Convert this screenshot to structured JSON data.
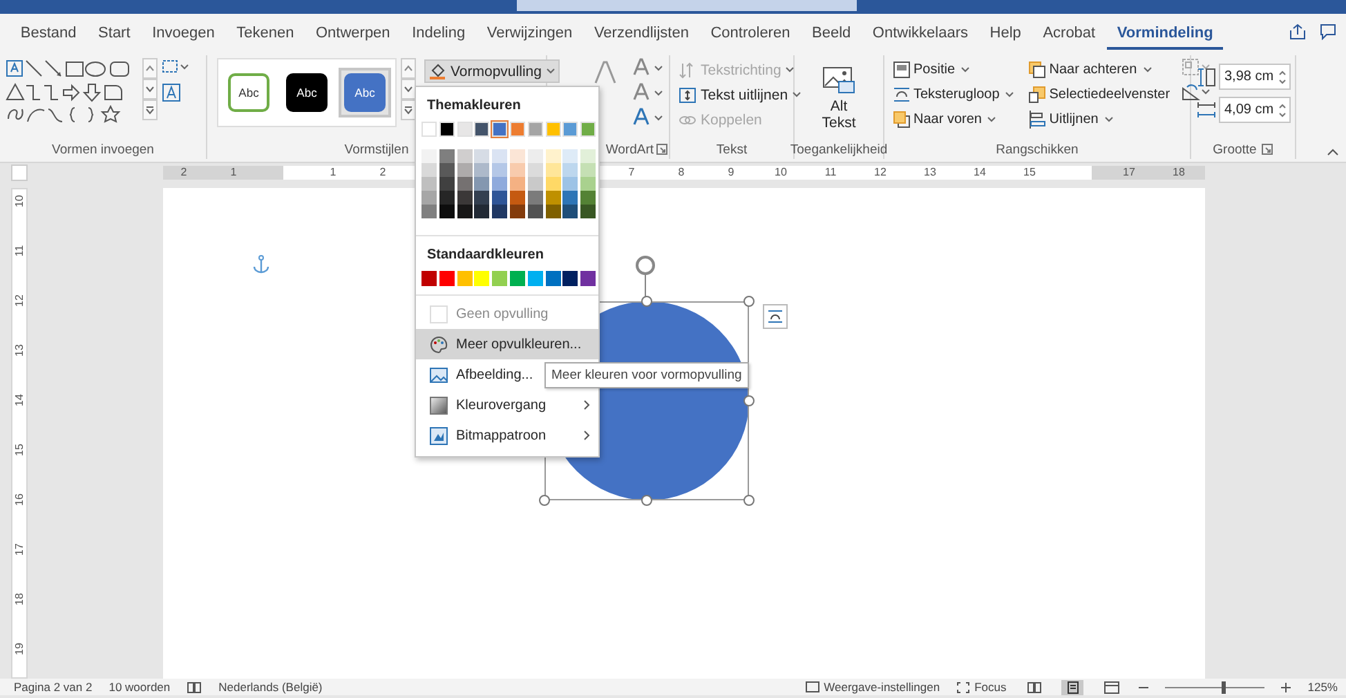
{
  "tabs": [
    {
      "label": "Bestand",
      "selected": false
    },
    {
      "label": "Start",
      "selected": false
    },
    {
      "label": "Invoegen",
      "selected": false
    },
    {
      "label": "Tekenen",
      "selected": false
    },
    {
      "label": "Ontwerpen",
      "selected": false
    },
    {
      "label": "Indeling",
      "selected": false
    },
    {
      "label": "Verwijzingen",
      "selected": false
    },
    {
      "label": "Verzendlijsten",
      "selected": false
    },
    {
      "label": "Controleren",
      "selected": false
    },
    {
      "label": "Beeld",
      "selected": false
    },
    {
      "label": "Ontwikkelaars",
      "selected": false
    },
    {
      "label": "Help",
      "selected": false
    },
    {
      "label": "Acrobat",
      "selected": false
    },
    {
      "label": "Vormindeling",
      "selected": true
    }
  ],
  "ribbon": {
    "insert_shapes": {
      "label": "Vormen invoegen"
    },
    "shape_styles": {
      "label": "Vormstijlen",
      "fill_button": "Vormopvulling",
      "presets": [
        {
          "label": "Abc",
          "kind": "outline",
          "color": "#70ad47",
          "selected": false
        },
        {
          "label": "Abc",
          "kind": "filled",
          "color": "#000000",
          "selected": false
        },
        {
          "label": "Abc",
          "kind": "filled",
          "color": "#4472c4",
          "selected": true
        }
      ]
    },
    "wordart": {
      "label": "WordArt"
    },
    "text": {
      "label": "Tekst",
      "buttons": [
        {
          "label": "Tekstrichting",
          "kind": "direction",
          "disabled": true
        },
        {
          "label": "Tekst uitlijnen",
          "kind": "align",
          "disabled": false
        },
        {
          "label": "Koppelen",
          "kind": "link",
          "disabled": true
        }
      ]
    },
    "accessibility": {
      "label": "Toegankelijkheid",
      "button": "Alt Tekst"
    },
    "arrange": {
      "label": "Rangschikken",
      "buttons": [
        {
          "label": "Positie",
          "kind": "position",
          "dropdown": true
        },
        {
          "label": "Teksterugloop",
          "kind": "wrap",
          "dropdown": true
        },
        {
          "label": "Naar voren",
          "kind": "forward",
          "dropdown": true
        },
        {
          "label": "Naar achteren",
          "kind": "backward",
          "dropdown": true
        },
        {
          "label": "Selectiedeelvenster",
          "kind": "pane",
          "dropdown": false
        },
        {
          "label": "Uitlijnen",
          "kind": "align",
          "dropdown": true
        }
      ]
    },
    "size": {
      "label": "Grootte",
      "height": "3,98 cm",
      "width": "4,09 cm"
    }
  },
  "rulers": {
    "horizontal": [
      "2",
      "1",
      "1",
      "2",
      "7",
      "8",
      "9",
      "10",
      "11",
      "12",
      "13",
      "14",
      "15",
      "17",
      "18"
    ],
    "vertical": [
      "10",
      "11",
      "12",
      "13",
      "14",
      "15",
      "16",
      "17",
      "18",
      "19"
    ]
  },
  "shape": {
    "selected": true
  },
  "fill_menu": {
    "theme_title": "Themakleuren",
    "theme_colors": [
      {
        "color": "#ffffff",
        "shades": [
          {
            "color": "#f2f2f2"
          },
          {
            "color": "#d9d9d9"
          },
          {
            "color": "#bfbfbf"
          },
          {
            "color": "#a6a6a6"
          },
          {
            "color": "#808080"
          }
        ],
        "selected": false
      },
      {
        "color": "#000000",
        "shades": [
          {
            "color": "#7f7f7f"
          },
          {
            "color": "#595959"
          },
          {
            "color": "#404040"
          },
          {
            "color": "#262626"
          },
          {
            "color": "#0d0d0d"
          }
        ],
        "selected": false
      },
      {
        "color": "#e7e6e6",
        "shades": [
          {
            "color": "#d0cece"
          },
          {
            "color": "#aeabab"
          },
          {
            "color": "#757171"
          },
          {
            "color": "#3b3838"
          },
          {
            "color": "#181717"
          }
        ],
        "selected": false
      },
      {
        "color": "#44546a",
        "shades": [
          {
            "color": "#d6dce5"
          },
          {
            "color": "#adb9ca"
          },
          {
            "color": "#8497b0"
          },
          {
            "color": "#333f50"
          },
          {
            "color": "#222a35"
          }
        ],
        "selected": false
      },
      {
        "color": "#4472c4",
        "shades": [
          {
            "color": "#dae3f3"
          },
          {
            "color": "#b4c7e7"
          },
          {
            "color": "#8faadc"
          },
          {
            "color": "#2f5597"
          },
          {
            "color": "#203864"
          }
        ],
        "selected": true
      },
      {
        "color": "#ed7d31",
        "shades": [
          {
            "color": "#fbe5d6"
          },
          {
            "color": "#f8cbad"
          },
          {
            "color": "#f4b183"
          },
          {
            "color": "#c55a11"
          },
          {
            "color": "#843c0c"
          }
        ],
        "selected": false
      },
      {
        "color": "#a5a5a5",
        "shades": [
          {
            "color": "#ededed"
          },
          {
            "color": "#dbdbdb"
          },
          {
            "color": "#c9c9c9"
          },
          {
            "color": "#7b7b7b"
          },
          {
            "color": "#525252"
          }
        ],
        "selected": false
      },
      {
        "color": "#ffc000",
        "shades": [
          {
            "color": "#fff2cc"
          },
          {
            "color": "#ffe699"
          },
          {
            "color": "#ffd966"
          },
          {
            "color": "#bf9000"
          },
          {
            "color": "#7f6000"
          }
        ],
        "selected": false
      },
      {
        "color": "#5b9bd5",
        "shades": [
          {
            "color": "#deebf7"
          },
          {
            "color": "#bdd7ee"
          },
          {
            "color": "#9dc3e6"
          },
          {
            "color": "#2e75b6"
          },
          {
            "color": "#1f4e79"
          }
        ],
        "selected": false
      },
      {
        "color": "#70ad47",
        "shades": [
          {
            "color": "#e2f0d9"
          },
          {
            "color": "#c5e0b4"
          },
          {
            "color": "#a9d18e"
          },
          {
            "color": "#548235"
          },
          {
            "color": "#385723"
          }
        ],
        "selected": false
      }
    ],
    "standard_title": "Standaardkleuren",
    "standard_colors": [
      {
        "color": "#c00000"
      },
      {
        "color": "#ff0000"
      },
      {
        "color": "#ffc000"
      },
      {
        "color": "#ffff00"
      },
      {
        "color": "#92d050"
      },
      {
        "color": "#00b050"
      },
      {
        "color": "#00b0f0"
      },
      {
        "color": "#0070c0"
      },
      {
        "color": "#002060"
      },
      {
        "color": "#7030a0"
      }
    ],
    "items": [
      {
        "label": "Geen opvulling",
        "kind": "none",
        "disabled": true,
        "selected": false,
        "submenu": false
      },
      {
        "label": "Meer opvulkleuren...",
        "kind": "palette",
        "disabled": false,
        "selected": true,
        "submenu": false
      },
      {
        "label": "Afbeelding...",
        "kind": "picture",
        "disabled": false,
        "selected": false,
        "submenu": false
      },
      {
        "label": "Kleurovergang",
        "kind": "gradient",
        "disabled": false,
        "selected": false,
        "submenu": true
      },
      {
        "label": "Bitmappatroon",
        "kind": "texture",
        "disabled": false,
        "selected": false,
        "submenu": true
      }
    ]
  },
  "tooltip": "Meer kleuren voor vormopvulling",
  "status_bar": {
    "page": "Pagina 2 van 2",
    "words": "10 woorden",
    "language": "Nederlands (België)",
    "display_settings": "Weergave-instellingen",
    "focus": "Focus",
    "views": [
      {
        "kind": "read",
        "selected": false
      },
      {
        "kind": "print",
        "selected": true
      },
      {
        "kind": "web",
        "selected": false
      }
    ],
    "zoom": {
      "level": 0.58,
      "reading": "125%"
    }
  }
}
